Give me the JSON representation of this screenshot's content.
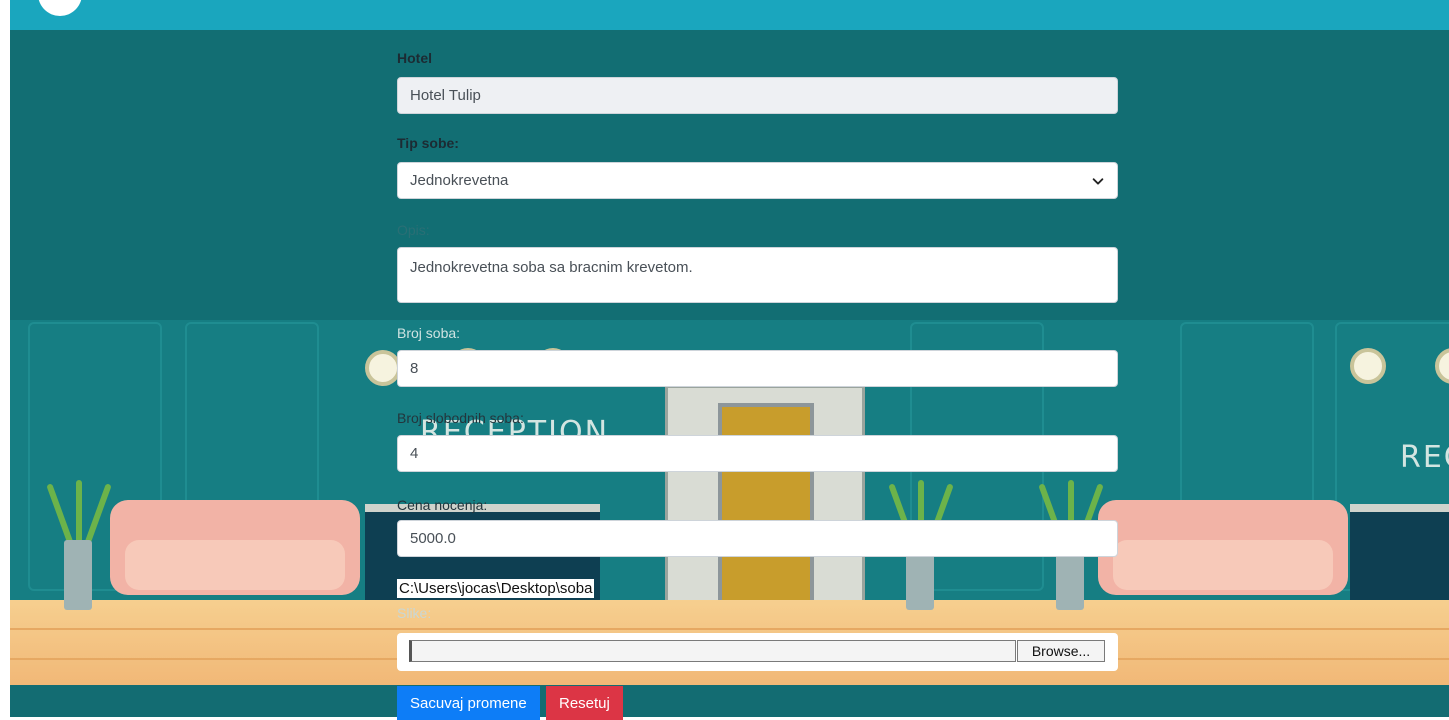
{
  "form": {
    "hotel": {
      "label": "Hotel",
      "value": "Hotel Tulip"
    },
    "room_type": {
      "label": "Tip sobe:",
      "selected": "Jednokrevetna"
    },
    "description": {
      "label": "Opis:",
      "value": "Jednokrevetna soba sa bracnim krevetom."
    },
    "room_count": {
      "label": "Broj soba:",
      "value": "8"
    },
    "free_rooms": {
      "label": "Broj slobodnih soba:",
      "value": "4"
    },
    "price": {
      "label": "Cena nocenja:",
      "value": "5000.0"
    },
    "image_path": "C:\\Users\\jocas\\Desktop\\soba",
    "image": {
      "label": "Slike:",
      "browse_label": "Browse..."
    },
    "save_label": "Sacuvaj promene",
    "reset_label": "Resetuj"
  },
  "background": {
    "reception_sign_left": "RECEPTION",
    "reception_sign_right": "REC"
  },
  "colors": {
    "topbar": "#1aa6be",
    "wall": "#126e73",
    "primary": "#0d7df7",
    "danger": "#dc3545"
  }
}
